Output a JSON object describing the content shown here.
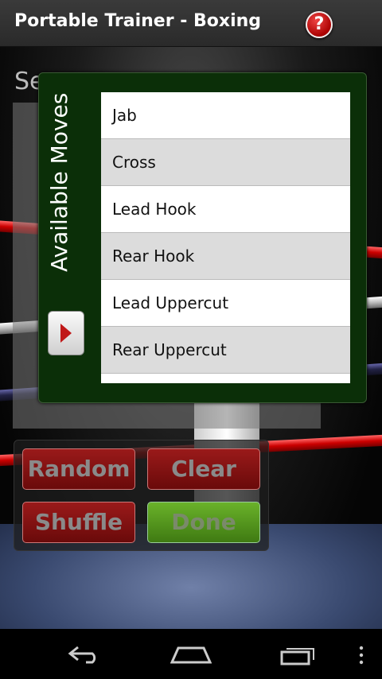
{
  "app": {
    "title": "Portable Trainer - Boxing",
    "help_glyph": "?"
  },
  "background": {
    "sequence_label": "Se"
  },
  "dialog": {
    "title": "Available Moves",
    "moves": [
      "Jab",
      "Cross",
      "Lead Hook",
      "Rear Hook",
      "Lead Uppercut",
      "Rear Uppercut"
    ]
  },
  "buttons": {
    "random": "Random",
    "clear": "Clear",
    "shuffle": "Shuffle",
    "done": "Done"
  },
  "colors": {
    "accent_red": "#c01818",
    "dialog_green": "#0b2f08",
    "done_green": "#5aa01e"
  },
  "nav": {
    "icons": [
      "back-icon",
      "home-icon",
      "recent-apps-icon",
      "overflow-menu-icon"
    ]
  }
}
